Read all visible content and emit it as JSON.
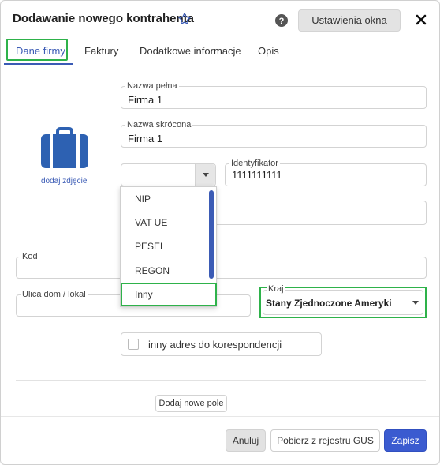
{
  "dialog": {
    "title": "Dodawanie nowego kontrahenta",
    "settings_label": "Ustawienia okna"
  },
  "tabs": [
    {
      "label": "Dane firmy"
    },
    {
      "label": "Faktury"
    },
    {
      "label": "Dodatkowe informacje"
    },
    {
      "label": "Opis"
    }
  ],
  "form": {
    "full_name_label": "Nazwa pełna",
    "full_name_value": "Firma 1",
    "short_name_label": "Nazwa skrócona",
    "short_name_value": "Firma 1",
    "add_photo": "dodaj zdjęcie",
    "identifier_label": "Identyfikator",
    "identifier_value": "1111111111",
    "code_label": "Kod",
    "street_label": "Ulica dom / lokal",
    "country_label": "Kraj",
    "country_value": "Stany Zjednoczone Ameryki",
    "alt_address_label": "inny adres do korespondencji",
    "add_field_label": "Dodaj nowe pole"
  },
  "id_type_options": [
    "NIP",
    "VAT UE",
    "PESEL",
    "REGON",
    "Inny"
  ],
  "footer": {
    "cancel": "Anuluj",
    "gus": "Pobierz z rejestru GUS",
    "save": "Zapisz"
  },
  "colors": {
    "accent_blue": "#3b5bb5",
    "highlight_green": "#2eb24a",
    "save_button": "#3b5bd0"
  },
  "icons": [
    "star-icon",
    "help-icon",
    "close-icon",
    "briefcase-icon",
    "chevron-down-icon"
  ]
}
